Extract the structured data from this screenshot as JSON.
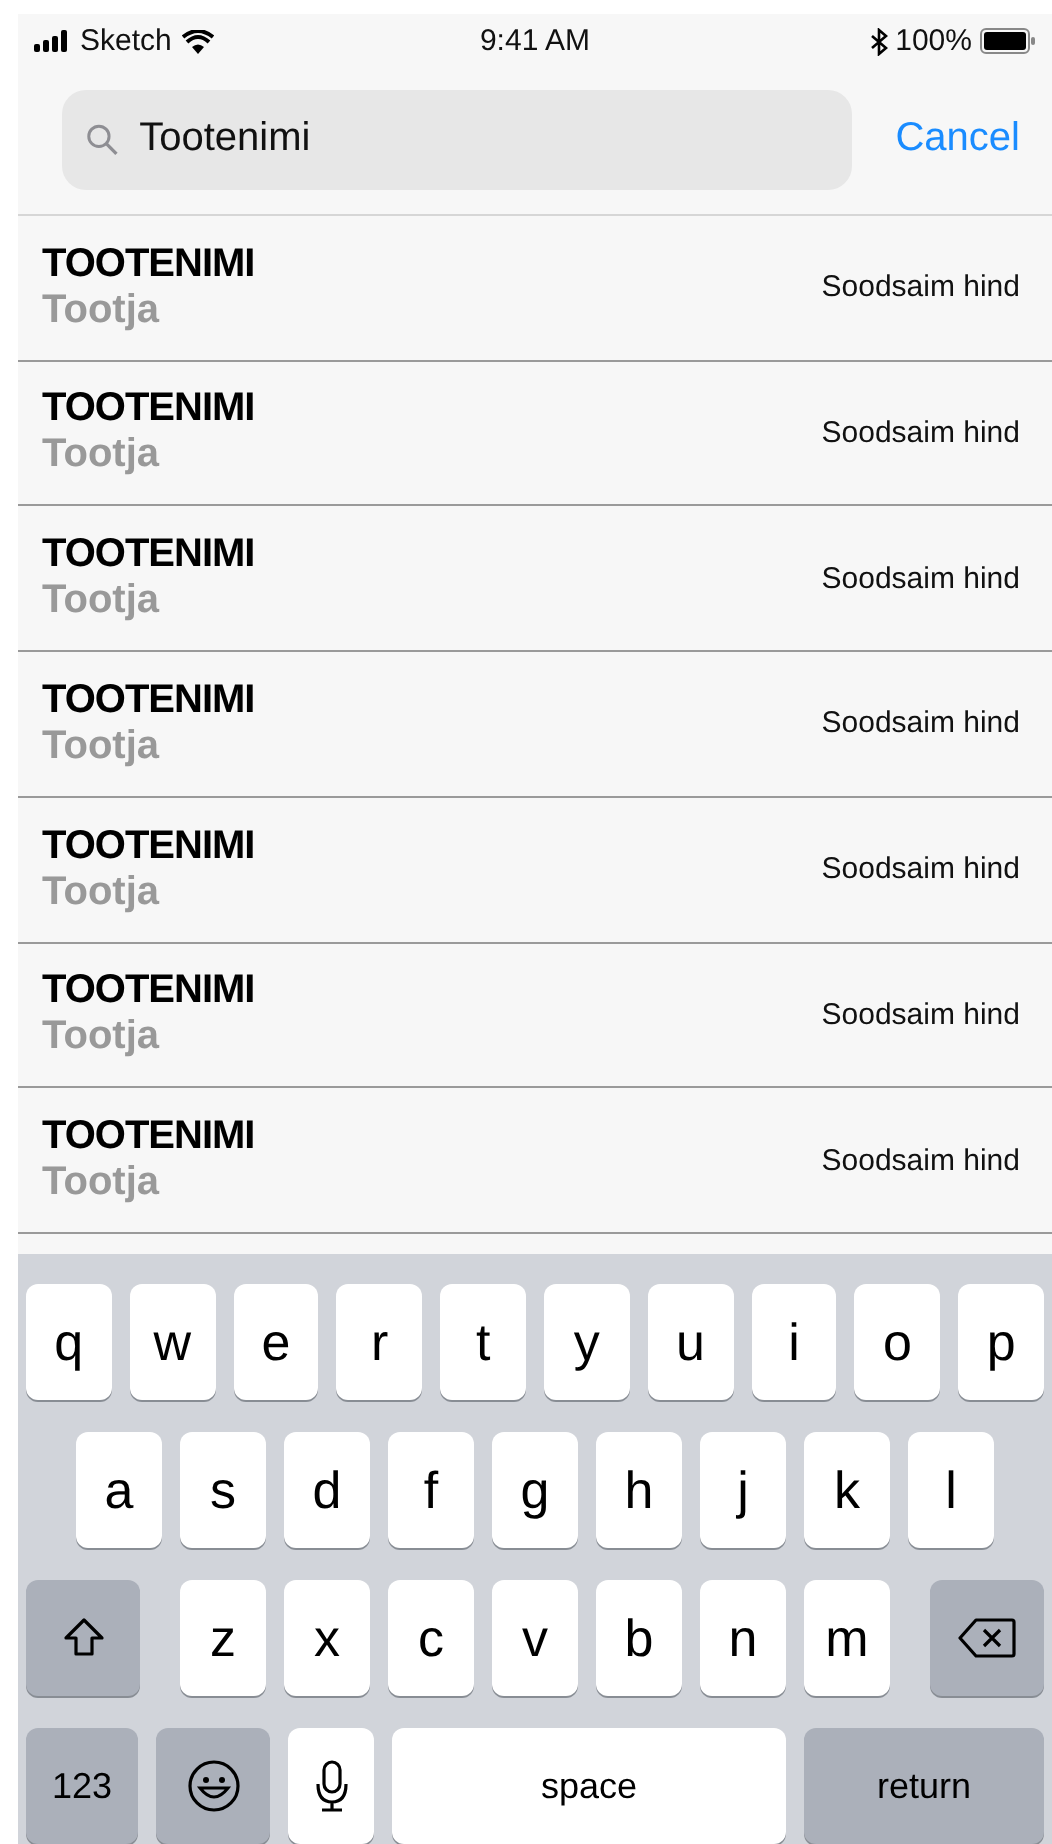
{
  "status_bar": {
    "carrier": "Sketch",
    "time": "9:41 AM",
    "battery": "100%"
  },
  "search": {
    "value": "Tootenimi",
    "cancel": "Cancel"
  },
  "results": [
    {
      "name": "TOOTENIMI",
      "maker": "Tootja",
      "price": "Soodsaim hind"
    },
    {
      "name": "TOOTENIMI",
      "maker": "Tootja",
      "price": "Soodsaim hind"
    },
    {
      "name": "TOOTENIMI",
      "maker": "Tootja",
      "price": "Soodsaim hind"
    },
    {
      "name": "TOOTENIMI",
      "maker": "Tootja",
      "price": "Soodsaim hind"
    },
    {
      "name": "TOOTENIMI",
      "maker": "Tootja",
      "price": "Soodsaim hind"
    },
    {
      "name": "TOOTENIMI",
      "maker": "Tootja",
      "price": "Soodsaim hind"
    },
    {
      "name": "TOOTENIMI",
      "maker": "Tootja",
      "price": "Soodsaim hind"
    }
  ],
  "keyboard": {
    "key_rows": [
      {
        "keys": [
          {
            "kind": "letter",
            "label": "q"
          },
          {
            "kind": "letter",
            "label": "w"
          },
          {
            "kind": "letter",
            "label": "e"
          },
          {
            "kind": "letter",
            "label": "r"
          },
          {
            "kind": "letter",
            "label": "t"
          },
          {
            "kind": "letter",
            "label": "y"
          },
          {
            "kind": "letter",
            "label": "u"
          },
          {
            "kind": "letter",
            "label": "i"
          },
          {
            "kind": "letter",
            "label": "o"
          },
          {
            "kind": "letter",
            "label": "p"
          }
        ]
      },
      {
        "keys": [
          {
            "kind": "letter",
            "label": "a"
          },
          {
            "kind": "letter",
            "label": "s"
          },
          {
            "kind": "letter",
            "label": "d"
          },
          {
            "kind": "letter",
            "label": "f"
          },
          {
            "kind": "letter",
            "label": "g"
          },
          {
            "kind": "letter",
            "label": "h"
          },
          {
            "kind": "letter",
            "label": "j"
          },
          {
            "kind": "letter",
            "label": "k"
          },
          {
            "kind": "letter",
            "label": "l"
          }
        ]
      },
      {
        "keys": [
          {
            "kind": "shift"
          },
          {
            "kind": "letter",
            "label": "z"
          },
          {
            "kind": "letter",
            "label": "x"
          },
          {
            "kind": "letter",
            "label": "c"
          },
          {
            "kind": "letter",
            "label": "v"
          },
          {
            "kind": "letter",
            "label": "b"
          },
          {
            "kind": "letter",
            "label": "n"
          },
          {
            "kind": "letter",
            "label": "m"
          },
          {
            "kind": "delete"
          }
        ]
      },
      {
        "keys": [
          {
            "kind": "numbers",
            "label": "123"
          },
          {
            "kind": "emoji"
          },
          {
            "kind": "mic"
          },
          {
            "kind": "space",
            "label": "space"
          },
          {
            "kind": "return",
            "label": "return"
          }
        ]
      }
    ]
  }
}
